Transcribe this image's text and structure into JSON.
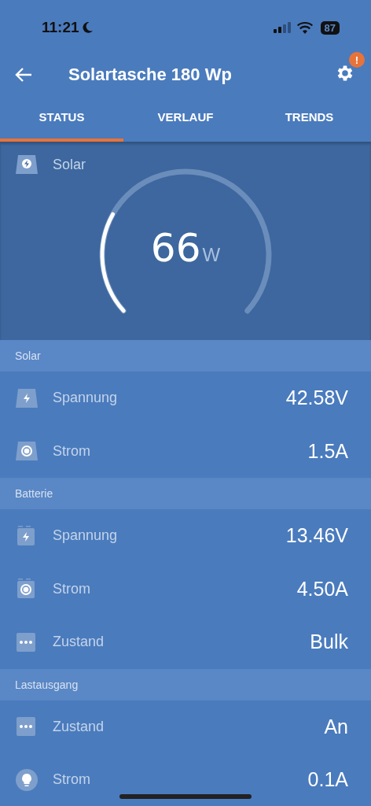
{
  "status_bar": {
    "time": "11:21",
    "battery": "87"
  },
  "header": {
    "title": "Solartasche 180 Wp",
    "settings_alert": "!"
  },
  "tabs": [
    {
      "label": "STATUS",
      "selected": true
    },
    {
      "label": "VERLAUF",
      "selected": false
    },
    {
      "label": "TRENDS",
      "selected": false
    }
  ],
  "gauge": {
    "label": "Solar",
    "value": "66",
    "unit": "W"
  },
  "sections": [
    {
      "title": "Solar",
      "rows": [
        {
          "kind": "panel-bolt",
          "label": "Spannung",
          "value": "42.58V"
        },
        {
          "kind": "panel-dot",
          "label": "Strom",
          "value": "1.5A"
        }
      ]
    },
    {
      "title": "Batterie",
      "rows": [
        {
          "kind": "battery-bolt",
          "label": "Spannung",
          "value": "13.46V"
        },
        {
          "kind": "battery-dot",
          "label": "Strom",
          "value": "4.50A"
        },
        {
          "kind": "dots",
          "label": "Zustand",
          "value": "Bulk"
        }
      ]
    },
    {
      "title": "Lastausgang",
      "rows": [
        {
          "kind": "dots",
          "label": "Zustand",
          "value": "An"
        },
        {
          "kind": "bulb",
          "label": "Strom",
          "value": "0.1A"
        }
      ]
    }
  ]
}
